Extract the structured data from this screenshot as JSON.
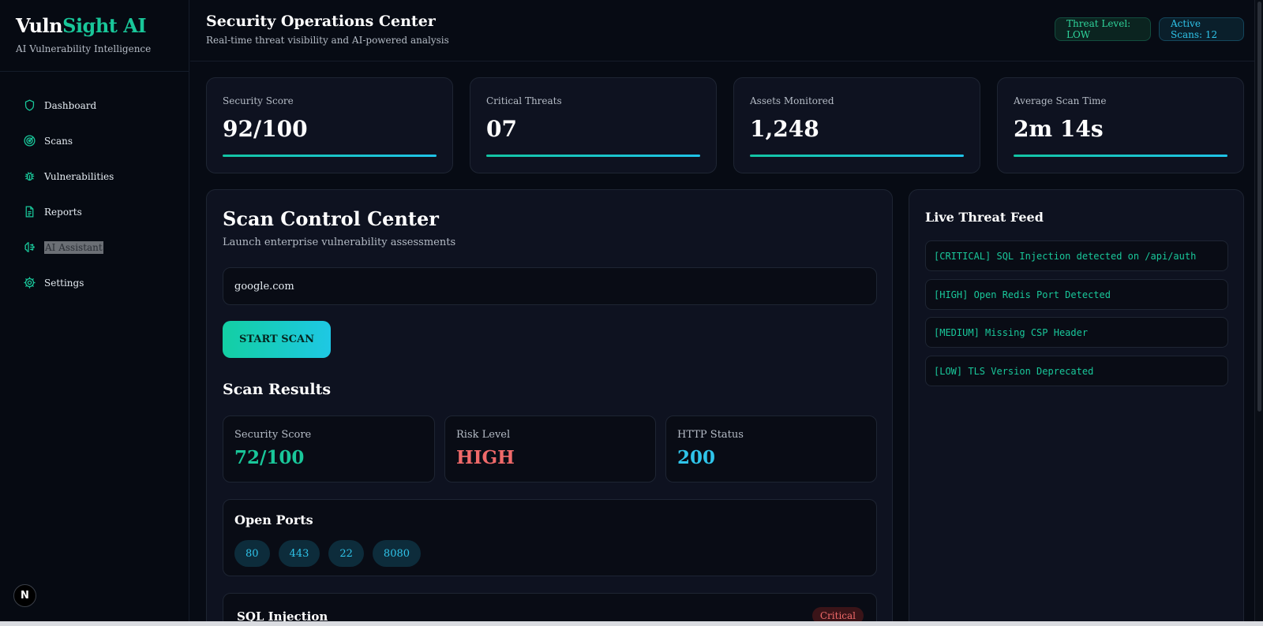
{
  "brand": {
    "name_part1": "Vuln",
    "name_part2": "Sight AI",
    "subtitle": "AI Vulnerability Intelligence"
  },
  "sidebar": {
    "items": [
      {
        "label": "Dashboard",
        "icon": "shield-icon"
      },
      {
        "label": "Scans",
        "icon": "radar-icon"
      },
      {
        "label": "Vulnerabilities",
        "icon": "bug-icon"
      },
      {
        "label": "Reports",
        "icon": "file-text-icon"
      },
      {
        "label": "AI Assistant",
        "icon": "brain-icon"
      },
      {
        "label": "Settings",
        "icon": "gear-icon"
      }
    ],
    "footer_badge": "N"
  },
  "header": {
    "title": "Security Operations Center",
    "subtitle": "Real-time threat visibility and AI-powered analysis",
    "threat_level": "Threat Level: LOW",
    "active_scans": "Active Scans: 12"
  },
  "stats": [
    {
      "label": "Security Score",
      "value": "92/100"
    },
    {
      "label": "Critical Threats",
      "value": "07"
    },
    {
      "label": "Assets Monitored",
      "value": "1,248"
    },
    {
      "label": "Average Scan Time",
      "value": "2m 14s"
    }
  ],
  "scan": {
    "title": "Scan Control Center",
    "subtitle": "Launch enterprise vulnerability assessments",
    "target_value": "google.com",
    "start_label": "START SCAN",
    "results_title": "Scan Results",
    "results": [
      {
        "label": "Security Score",
        "value": "72/100",
        "color": "#19c79a"
      },
      {
        "label": "Risk Level",
        "value": "HIGH",
        "color": "#f06a6a"
      },
      {
        "label": "HTTP Status",
        "value": "200",
        "color": "#2fc4ea"
      }
    ],
    "ports_title": "Open Ports",
    "ports": [
      "80",
      "443",
      "22",
      "8080"
    ],
    "vuln_name": "SQL Injection",
    "vuln_severity": "Critical"
  },
  "feed": {
    "title": "Live Threat Feed",
    "items": [
      "[CRITICAL] SQL Injection detected on /api/auth",
      "[HIGH] Open Redis Port Detected",
      "[MEDIUM] Missing CSP Header",
      "[LOW] TLS Version Deprecated"
    ]
  }
}
